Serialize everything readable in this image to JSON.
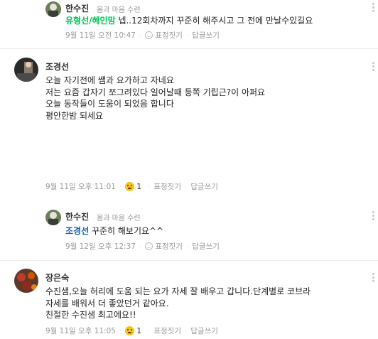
{
  "comments": [
    {
      "name": "한수진",
      "grade": "몸과 마음 수련",
      "mention": "유형선/혜인맘",
      "text": "넵..12회차까지 꾸준히 해주시고 그 전에 만날수있길요",
      "time": "9월 11일 오전 10:47",
      "emotion_label": "표정짓기",
      "reply_label": "답글쓰기"
    },
    {
      "name": "조경선",
      "lines": [
        "오늘  자기전에 쌤과 요가하고 자네요",
        "저는 요즘 갑자기 쪼그려있다 일어날때 등쪽 기립근?이 아퍼요",
        "오늘 동작들이 도움이 되었음 합니다",
        "평안한밤 되세요"
      ],
      "time": "9월 11일 오후 11:01",
      "emotion_count": "1",
      "emotion_label": "표정짓기",
      "reply_label": "답글쓰기"
    },
    {
      "name": "한수진",
      "grade": "몸과 마음 수련",
      "mention": "조경선",
      "text": "꾸준히 해보기요^^",
      "time": "9월 12일 오후 12:37",
      "emotion_label": "표정짓기",
      "reply_label": "답글쓰기"
    },
    {
      "name": "장은숙",
      "lines": [
        "수진샘,오늘 허리에 도움 되는 요가 자세 잘 배우고 갑니다.단계별로 코브라",
        "자세를 배워서 더 좋았던거 같아요.",
        "친절한 수진샘 최고에요!!"
      ],
      "time": "9월 11일 오후 11:05",
      "emotion_count": "1",
      "emotion_label": "표정짓기",
      "reply_label": "답글쓰기"
    }
  ]
}
